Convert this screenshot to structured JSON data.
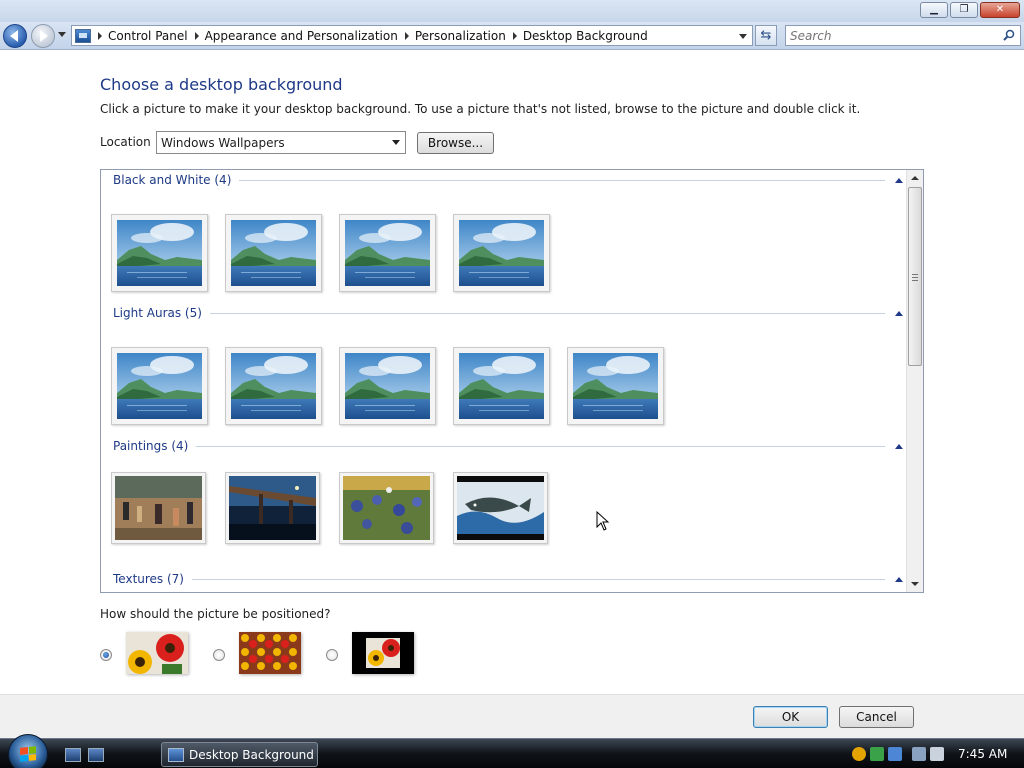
{
  "window": {
    "minimize_glyph": "▁",
    "maximize_glyph": "❐",
    "close_glyph": "✕"
  },
  "address": {
    "breadcrumbs": [
      "Control Panel",
      "Appearance and Personalization",
      "Personalization",
      "Desktop Background"
    ]
  },
  "search": {
    "placeholder": "Search"
  },
  "page": {
    "title": "Choose a desktop background",
    "description": "Click a picture to make it your desktop background. To use a picture that's not listed, browse to the picture and double click it."
  },
  "location": {
    "label": "Location",
    "selected": "Windows Wallpapers",
    "browse_label": "Browse..."
  },
  "gallery": {
    "groups": [
      {
        "title": "Black and White (4)"
      },
      {
        "title": "Light Auras (5)"
      },
      {
        "title": "Paintings (4)"
      },
      {
        "title": "Textures (7)"
      }
    ]
  },
  "positioning": {
    "question": "How should the picture be positioned?",
    "options": [
      "fit-to-screen",
      "tile",
      "center"
    ],
    "selected": "fit-to-screen"
  },
  "buttons": {
    "ok": "OK",
    "cancel": "Cancel"
  },
  "taskbar": {
    "task_label": "Desktop Background",
    "clock": "7:45 AM"
  },
  "colors": {
    "title_blue": "#1e3a87",
    "ok_border": "#3c7fb1"
  }
}
